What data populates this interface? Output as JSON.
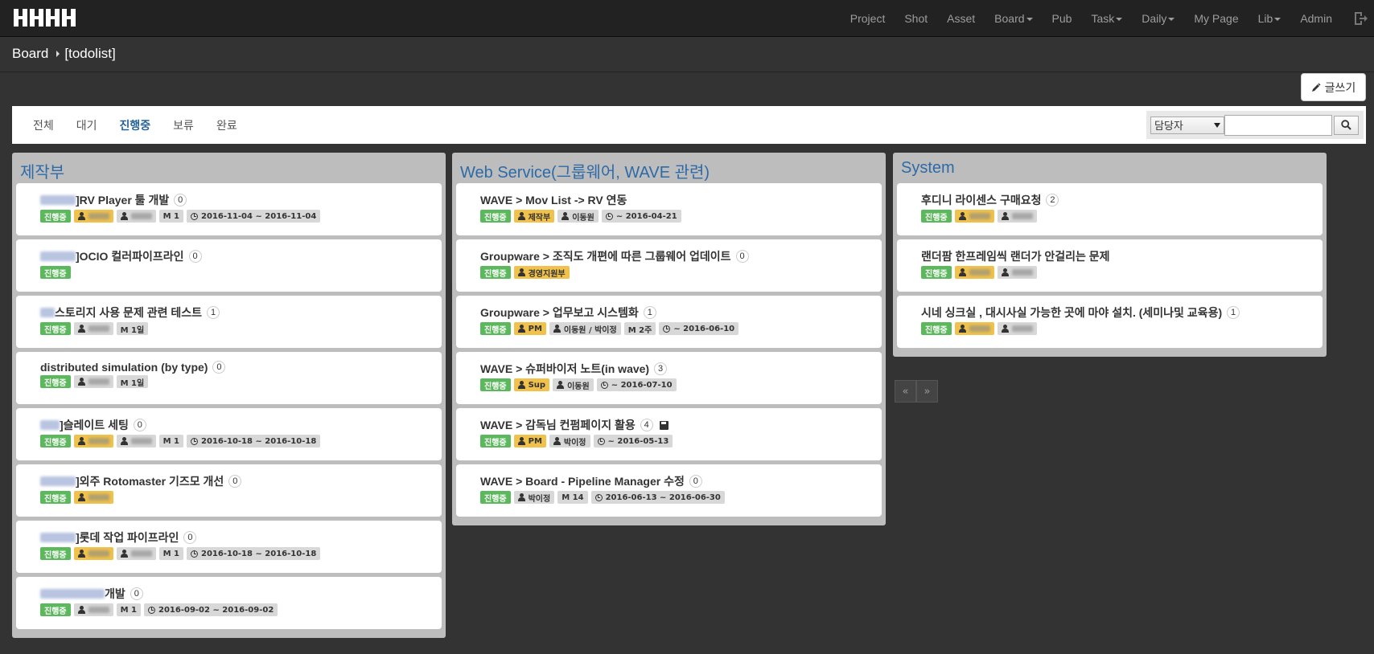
{
  "nav": {
    "items": [
      {
        "label": "Project",
        "caret": false
      },
      {
        "label": "Shot",
        "caret": false
      },
      {
        "label": "Asset",
        "caret": false
      },
      {
        "label": "Board",
        "caret": true
      },
      {
        "label": "Pub",
        "caret": false
      },
      {
        "label": "Task",
        "caret": true
      },
      {
        "label": "Daily",
        "caret": true
      },
      {
        "label": "My Page",
        "caret": false
      },
      {
        "label": "Lib",
        "caret": true
      },
      {
        "label": "Admin",
        "caret": false
      }
    ],
    "logout_icon": "sign-out-icon"
  },
  "breadcrumb": {
    "root": "Board",
    "current": "[todolist]"
  },
  "write_button": {
    "label": "글쓰기",
    "icon": "pencil-icon"
  },
  "tabs": [
    "전체",
    "대기",
    "진행중",
    "보류",
    "완료"
  ],
  "active_tab": "진행중",
  "search": {
    "select_value": "담당자",
    "input_value": "",
    "button_icon": "search-icon"
  },
  "colors": {
    "accent": "#2d6aa8",
    "status_green": "#5cb85c",
    "tag_yellow": "#f0c24b",
    "tag_gray": "#d8d8d8"
  },
  "columns": [
    {
      "title": "제작부",
      "cards": [
        {
          "prefix_blur": 44,
          "title": "]RV Player 툴 개발",
          "count": "0",
          "labels": [
            {
              "type": "status",
              "text": "진행중"
            },
            {
              "type": "yellow",
              "icon": "user",
              "blur": true
            },
            {
              "type": "gray",
              "icon": "user",
              "blur": true
            },
            {
              "type": "gray",
              "text": "M 1"
            },
            {
              "type": "gray",
              "icon": "clock",
              "text": "2016-11-04 ~ 2016-11-04"
            }
          ]
        },
        {
          "prefix_blur": 44,
          "title": "]OCIO 컬러파이프라인",
          "count": "0",
          "labels": [
            {
              "type": "status",
              "text": "진행중"
            }
          ]
        },
        {
          "prefix_blur": 18,
          "title": "스토리지 사용 문제 관련 테스트",
          "count": "1",
          "labels": [
            {
              "type": "status",
              "text": "진행중"
            },
            {
              "type": "gray",
              "icon": "user",
              "blur": true
            },
            {
              "type": "gray",
              "text": "M 1일"
            }
          ]
        },
        {
          "prefix_blur": 0,
          "title": "distributed simulation (by type)",
          "count": "0",
          "labels": [
            {
              "type": "status",
              "text": "진행중"
            },
            {
              "type": "gray",
              "icon": "user",
              "blur": true
            },
            {
              "type": "gray",
              "text": "M 1일"
            }
          ]
        },
        {
          "prefix_blur": 24,
          "title": "]슬레이트 세팅",
          "count": "0",
          "labels": [
            {
              "type": "status",
              "text": "진행중"
            },
            {
              "type": "yellow",
              "icon": "user",
              "blur": true
            },
            {
              "type": "gray",
              "icon": "user",
              "blur": true
            },
            {
              "type": "gray",
              "text": "M 1"
            },
            {
              "type": "gray",
              "icon": "clock",
              "text": "2016-10-18 ~ 2016-10-18"
            }
          ]
        },
        {
          "prefix_blur": 44,
          "title": "]외주 Rotomaster 기즈모 개선",
          "count": "0",
          "labels": [
            {
              "type": "status",
              "text": "진행중"
            },
            {
              "type": "yellow",
              "icon": "user",
              "blur": true
            }
          ]
        },
        {
          "prefix_blur": 44,
          "title": "]롯데 작업 파이프라인",
          "count": "0",
          "labels": [
            {
              "type": "status",
              "text": "진행중"
            },
            {
              "type": "yellow",
              "icon": "user",
              "blur": true
            },
            {
              "type": "gray",
              "icon": "user",
              "blur": true
            },
            {
              "type": "gray",
              "text": "M 1"
            },
            {
              "type": "gray",
              "icon": "clock",
              "text": "2016-10-18 ~ 2016-10-18"
            }
          ]
        },
        {
          "prefix_blur": 80,
          "title": "개발",
          "count": "0",
          "labels": [
            {
              "type": "status",
              "text": "진행중"
            },
            {
              "type": "gray",
              "icon": "user",
              "blur": true
            },
            {
              "type": "gray",
              "text": "M 1"
            },
            {
              "type": "gray",
              "icon": "clock",
              "text": "2016-09-02 ~ 2016-09-02"
            }
          ]
        }
      ]
    },
    {
      "title": "Web Service(그룹웨어, WAVE 관련)",
      "cards": [
        {
          "prefix_blur": 0,
          "title": "WAVE > Mov List -> RV 연동",
          "count": "",
          "labels": [
            {
              "type": "status",
              "text": "진행중"
            },
            {
              "type": "yellow",
              "icon": "user",
              "text": "제작부"
            },
            {
              "type": "gray",
              "icon": "user",
              "text": "이동원"
            },
            {
              "type": "gray",
              "icon": "clock",
              "text": "~ 2016-04-21"
            }
          ]
        },
        {
          "prefix_blur": 0,
          "title": "Groupware > 조직도 개편에 따른 그룹웨어 업데이트",
          "count": "0",
          "labels": [
            {
              "type": "status",
              "text": "진행중"
            },
            {
              "type": "yellow",
              "icon": "user",
              "text": "경영지원부"
            }
          ]
        },
        {
          "prefix_blur": 0,
          "title": "Groupware > 업무보고 시스템화",
          "count": "1",
          "labels": [
            {
              "type": "status",
              "text": "진행중"
            },
            {
              "type": "yellow",
              "icon": "user",
              "text": "PM"
            },
            {
              "type": "gray",
              "icon": "user",
              "text": "이동원 / 박이정"
            },
            {
              "type": "gray",
              "text": "M 2주"
            },
            {
              "type": "gray",
              "icon": "clock",
              "text": "~ 2016-06-10"
            }
          ]
        },
        {
          "prefix_blur": 0,
          "title": "WAVE > 슈퍼바이저 노트(in wave)",
          "count": "3",
          "labels": [
            {
              "type": "status",
              "text": "진행중"
            },
            {
              "type": "yellow",
              "icon": "user",
              "text": "Sup"
            },
            {
              "type": "gray",
              "icon": "user",
              "text": "이동원"
            },
            {
              "type": "gray",
              "icon": "clock",
              "text": "~ 2016-07-10"
            }
          ]
        },
        {
          "prefix_blur": 0,
          "title": "WAVE > 감독님 컨펌페이지 활용",
          "count": "4",
          "save": true,
          "labels": [
            {
              "type": "status",
              "text": "진행중"
            },
            {
              "type": "yellow",
              "icon": "user",
              "text": "PM"
            },
            {
              "type": "gray",
              "icon": "user",
              "text": "박이정"
            },
            {
              "type": "gray",
              "icon": "clock",
              "text": "~ 2016-05-13"
            }
          ]
        },
        {
          "prefix_blur": 0,
          "title": "WAVE > Board - Pipeline Manager 수정",
          "count": "0",
          "labels": [
            {
              "type": "status",
              "text": "진행중"
            },
            {
              "type": "gray",
              "icon": "user",
              "text": "박이정"
            },
            {
              "type": "gray",
              "text": "M 14"
            },
            {
              "type": "gray",
              "icon": "clock",
              "text": "2016-06-13 ~ 2016-06-30"
            }
          ]
        }
      ]
    },
    {
      "title": "System",
      "cards": [
        {
          "prefix_blur": 0,
          "title": "후디니 라이센스 구매요청",
          "count": "2",
          "labels": [
            {
              "type": "status",
              "text": "진행중"
            },
            {
              "type": "yellow",
              "icon": "user",
              "blur": true
            },
            {
              "type": "gray",
              "icon": "user",
              "blur": true
            }
          ]
        },
        {
          "prefix_blur": 0,
          "title": "랜더팜 한프레임씩 랜더가 안걸리는 문제",
          "count": "",
          "labels": [
            {
              "type": "status",
              "text": "진행중"
            },
            {
              "type": "yellow",
              "icon": "user",
              "blur": true
            },
            {
              "type": "gray",
              "icon": "user",
              "blur": true
            }
          ]
        },
        {
          "prefix_blur": 0,
          "title": "시네 싱크실 , 대시사실 가능한 곳에 마야 설치. (세미나및 교육용)",
          "count": "1",
          "labels": [
            {
              "type": "status",
              "text": "진행중"
            },
            {
              "type": "yellow",
              "icon": "user",
              "blur": true
            },
            {
              "type": "gray",
              "icon": "user",
              "blur": true
            }
          ]
        }
      ]
    }
  ],
  "pager": {
    "prev": "«",
    "next": "»"
  }
}
